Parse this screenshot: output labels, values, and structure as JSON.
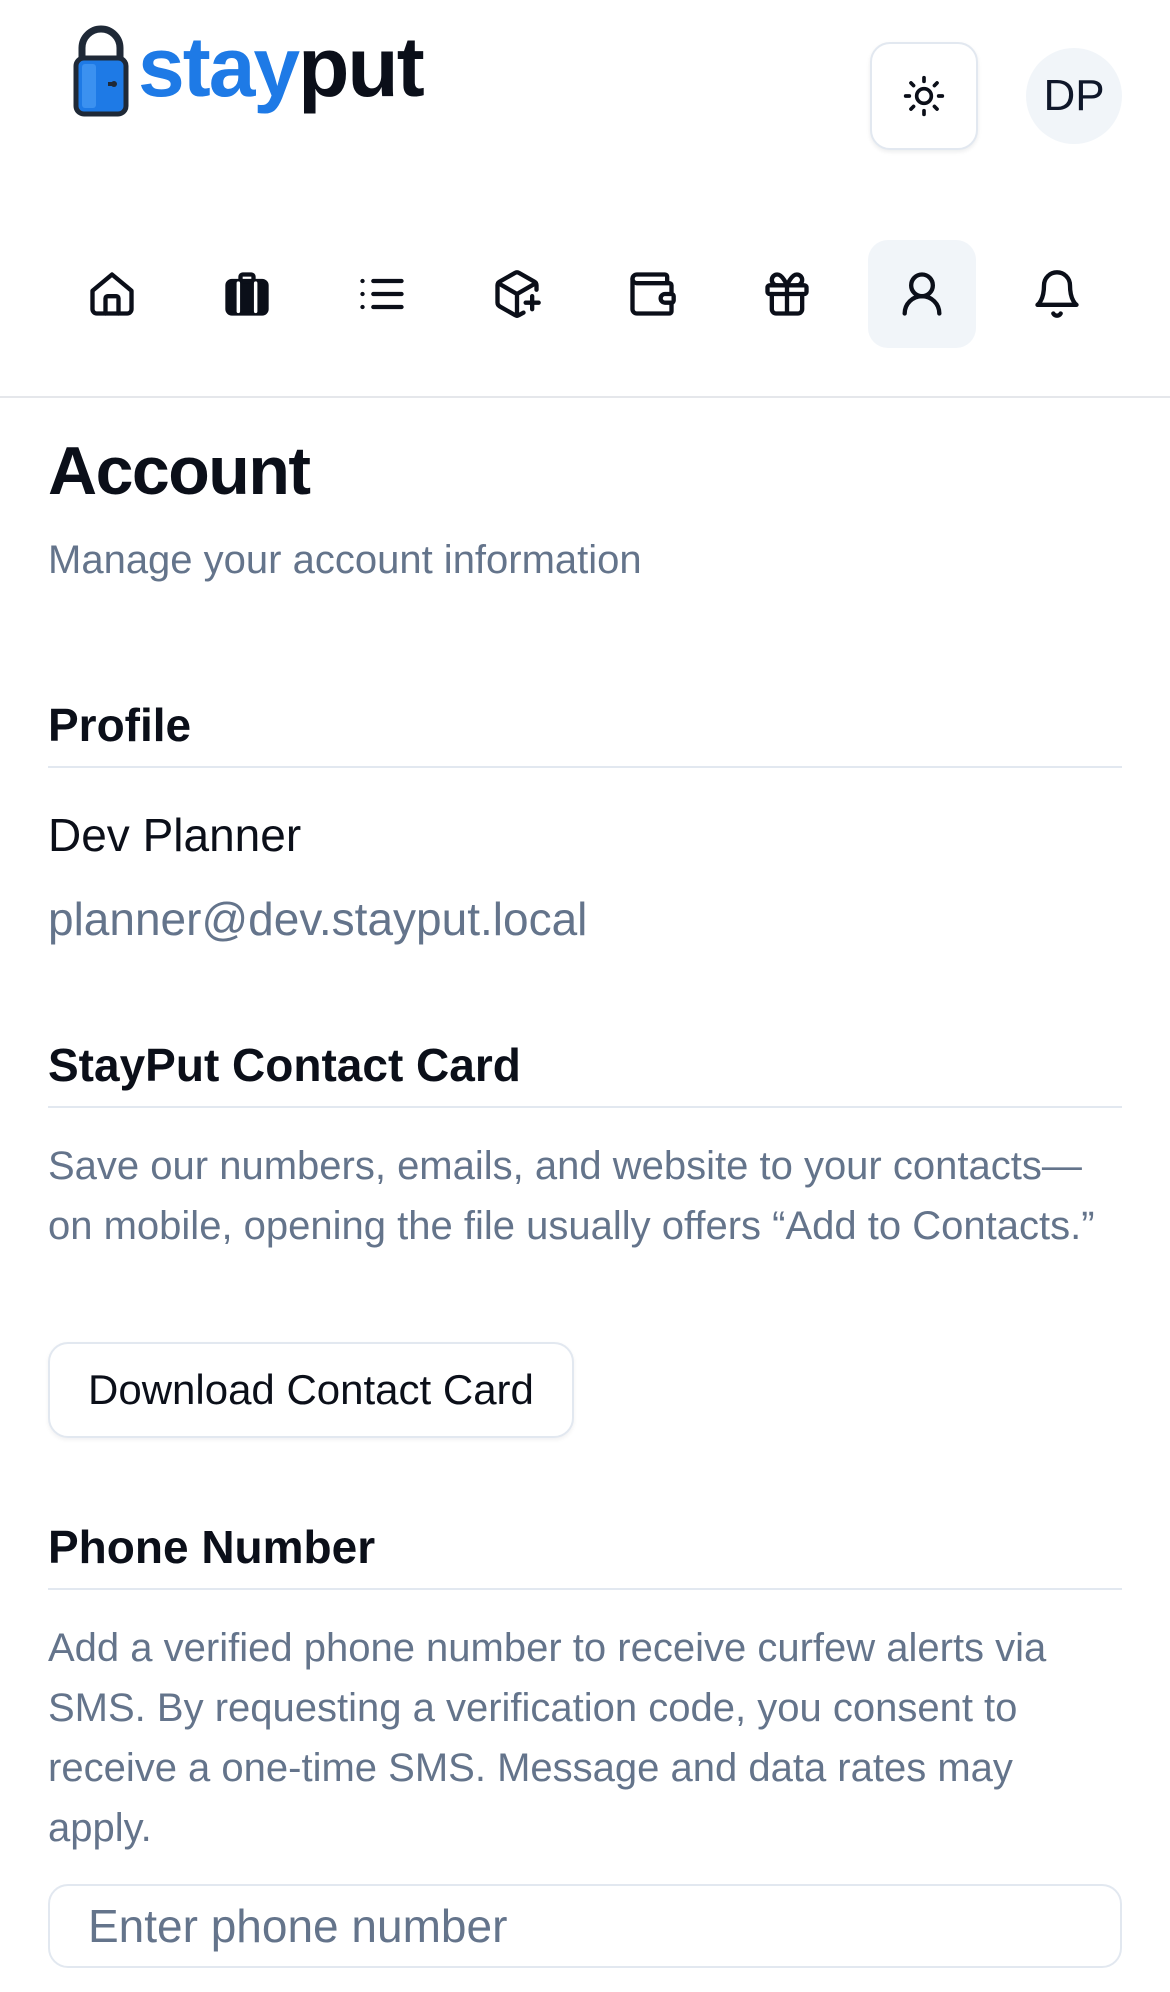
{
  "brand": {
    "part1": "stay",
    "part2": "put"
  },
  "header": {
    "avatar_initials": "DP"
  },
  "nav": [
    "home-icon",
    "luggage-icon",
    "list-icon",
    "package-plus-icon",
    "wallet-icon",
    "gift-icon",
    "user-icon",
    "bell-icon"
  ],
  "page": {
    "title": "Account",
    "subtitle": "Manage your account information"
  },
  "profile": {
    "heading": "Profile",
    "name": "Dev Planner",
    "email": "planner@dev.stayput.local"
  },
  "contact_card": {
    "heading": "StayPut Contact Card",
    "description": "Save our numbers, emails, and website to your contacts—on mobile, opening the file usually offers “Add to Contacts.”",
    "button_label": "Download Contact Card"
  },
  "phone": {
    "heading": "Phone Number",
    "description": "Add a verified phone number to receive curfew alerts via SMS. By requesting a verification code, you consent to receive a one-time SMS. Message and data rates may apply.",
    "placeholder": "Enter phone number"
  },
  "colors": {
    "brand_blue": "#1e7ae6",
    "text_dark": "#0b0f19",
    "text_muted": "#64748b",
    "border": "#e2e8f0",
    "active_bg": "#f1f5f9"
  }
}
